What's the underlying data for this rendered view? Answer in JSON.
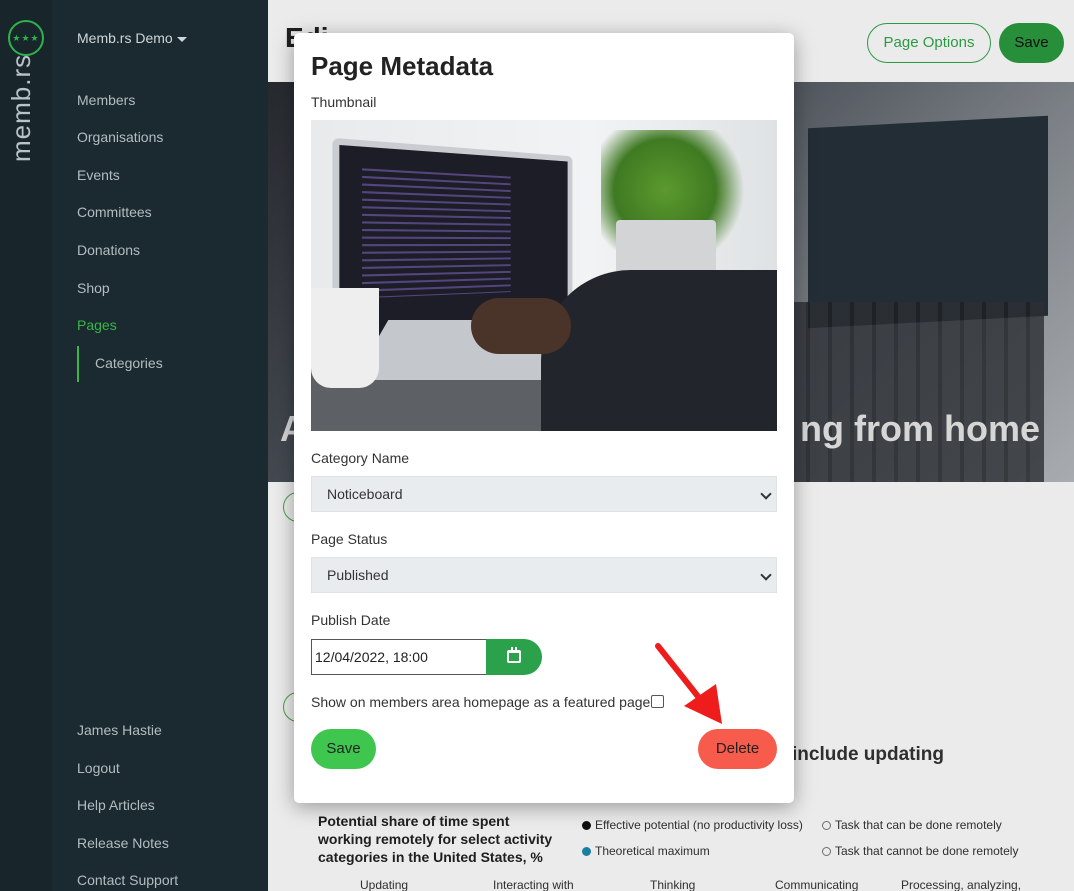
{
  "brand": {
    "name": "memb.rs",
    "badge": "★★★"
  },
  "sidebar": {
    "org": "Memb.rs Demo",
    "items": [
      {
        "label": "Members"
      },
      {
        "label": "Organisations"
      },
      {
        "label": "Events"
      },
      {
        "label": "Committees"
      },
      {
        "label": "Donations"
      },
      {
        "label": "Shop"
      },
      {
        "label": "Pages"
      }
    ],
    "sub_item": "Categories",
    "footer": [
      {
        "label": "James Hastie"
      },
      {
        "label": "Logout"
      },
      {
        "label": "Help Articles"
      },
      {
        "label": "Release Notes"
      },
      {
        "label": "Contact Support"
      }
    ]
  },
  "header": {
    "title": "Edi",
    "page_options": "Page Options",
    "save": "Save"
  },
  "hero": {
    "text_left": "A",
    "text_right": "ng from home"
  },
  "background": {
    "heading": "include updating",
    "chart_title": "Potential share of time spent working remotely for select activity categories in the United States, %",
    "legend": [
      "Effective potential (no productivity loss)",
      "Theoretical maximum",
      "Task that can be done remotely",
      "Task that cannot be done remotely"
    ],
    "columns": [
      "Updating",
      "Interacting with",
      "Thinking",
      "Communicating",
      "Processing, analyzing,"
    ],
    "colors": {
      "dark": "#111111",
      "blue": "#1a8ab0"
    }
  },
  "modal": {
    "title": "Page Metadata",
    "thumbnail_label": "Thumbnail",
    "category_label": "Category Name",
    "category_value": "Noticeboard",
    "status_label": "Page Status",
    "status_value": "Published",
    "publish_label": "Publish Date",
    "publish_value": "12/04/2022, 18:00",
    "featured_label": "Show on members area homepage as a featured page?",
    "save": "Save",
    "delete": "Delete"
  },
  "colors": {
    "accent": "#2aa14a",
    "danger": "#f65b4b",
    "sidebar": "#1a2a30"
  }
}
